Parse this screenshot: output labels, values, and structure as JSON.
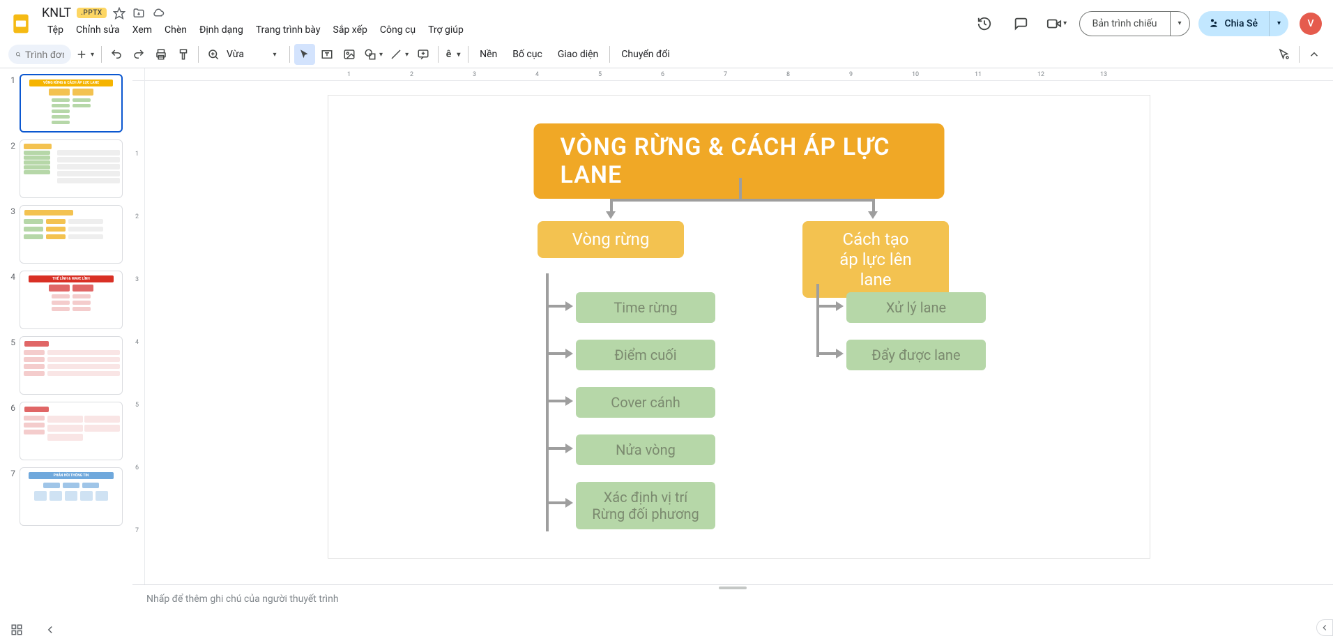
{
  "header": {
    "docTitle": "KNLT",
    "badge": ".PPTX",
    "menus": [
      "Tệp",
      "Chỉnh sửa",
      "Xem",
      "Chèn",
      "Định dạng",
      "Trang trình bày",
      "Sắp xếp",
      "Công cụ",
      "Trợ giúp"
    ],
    "presentLabel": "Bản trình chiếu",
    "shareLabel": "Chia Sẻ",
    "avatarLetter": "V"
  },
  "toolbar": {
    "searchPlaceholder": "Trình đơn",
    "zoomValue": "Vừa",
    "btnBackground": "Nền",
    "btnLayout": "Bố cục",
    "btnTheme": "Giao diện",
    "btnTransition": "Chuyển đổi"
  },
  "rulerH": [
    "1",
    "2",
    "3",
    "4",
    "5",
    "6",
    "7",
    "8",
    "9",
    "10",
    "11",
    "12",
    "13"
  ],
  "rulerV": [
    "1",
    "2",
    "3",
    "4",
    "5",
    "6",
    "7"
  ],
  "slide": {
    "title": "VÒNG RỪNG & CÁCH ÁP LỰC LANE",
    "left": {
      "heading": "Vòng rừng",
      "items": [
        "Time rừng",
        "Điểm cuối",
        "Cover cánh",
        "Nửa vòng",
        "Xác định vị trí\nRừng đối phương"
      ]
    },
    "right": {
      "heading": "Cách tạo\náp lực lên lane",
      "items": [
        "Xử lý lane",
        "Đẩy được lane"
      ]
    }
  },
  "notesPlaceholder": "Nhấp để thêm ghi chú của người thuyết trình",
  "thumbCount": 7
}
